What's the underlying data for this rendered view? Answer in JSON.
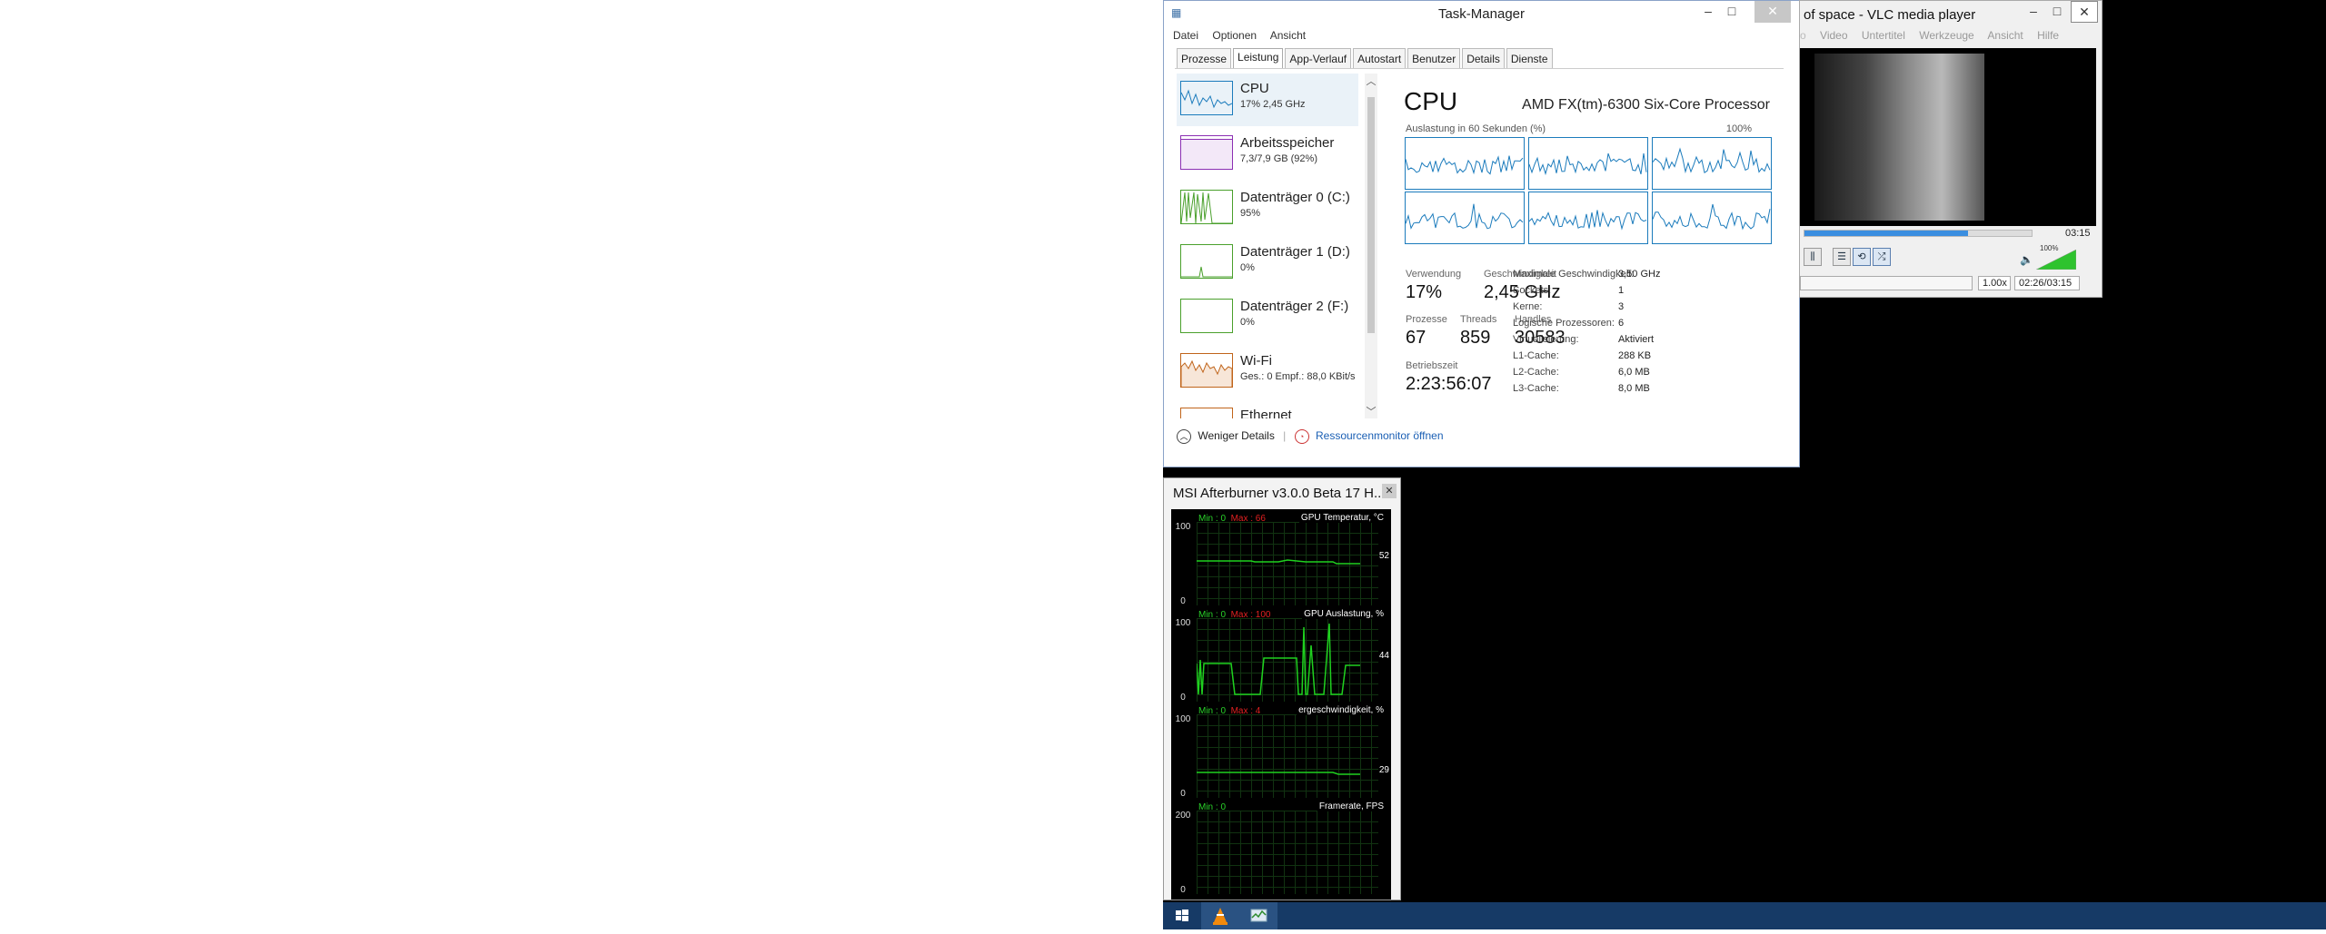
{
  "taskmanager": {
    "title": "Task-Manager",
    "menu": [
      "Datei",
      "Optionen",
      "Ansicht"
    ],
    "tabs": [
      "Prozesse",
      "Leistung",
      "App-Verlauf",
      "Autostart",
      "Benutzer",
      "Details",
      "Dienste"
    ],
    "active_tab": "Leistung",
    "sidebar": [
      {
        "title": "CPU",
        "sub": "17% 2,45 GHz",
        "color": "#1b7bbc"
      },
      {
        "title": "Arbeitsspeicher",
        "sub": "7,3/7,9 GB (92%)",
        "color": "#8b2fb3"
      },
      {
        "title": "Datenträger 0 (C:)",
        "sub": "95%",
        "color": "#4aa02c"
      },
      {
        "title": "Datenträger 1 (D:)",
        "sub": "0%",
        "color": "#4aa02c"
      },
      {
        "title": "Datenträger 2 (F:)",
        "sub": "0%",
        "color": "#4aa02c"
      },
      {
        "title": "Wi-Fi",
        "sub": "Ges.: 0 Empf.: 88,0 KBit/s",
        "color": "#c0641a"
      },
      {
        "title": "Ethernet",
        "sub": "",
        "color": "#c0641a"
      }
    ],
    "cpu": {
      "heading": "CPU",
      "model": "AMD FX(tm)-6300 Six-Core Processor",
      "usage_label": "Auslastung in 60 Sekunden (%)",
      "max_label": "100%",
      "stats": {
        "usage_label": "Verwendung",
        "usage": "17%",
        "speed_label": "Geschwindigkeit",
        "speed": "2,45 GHz",
        "processes_label": "Prozesse",
        "processes": "67",
        "threads_label": "Threads",
        "threads": "859",
        "handles_label": "Handles",
        "handles": "30583",
        "uptime_label": "Betriebszeit",
        "uptime": "2:23:56:07"
      },
      "details": [
        {
          "label": "Maximale Geschwindigkeit:",
          "value": "3,50 GHz"
        },
        {
          "label": "Sockets:",
          "value": "1"
        },
        {
          "label": "Kerne:",
          "value": "3"
        },
        {
          "label": "Logische Prozessoren:",
          "value": "6"
        },
        {
          "label": "Virtualisierung:",
          "value": "Aktiviert"
        },
        {
          "label": "L1-Cache:",
          "value": "288 KB"
        },
        {
          "label": "L2-Cache:",
          "value": "6,0 MB"
        },
        {
          "label": "L3-Cache:",
          "value": "8,0 MB"
        }
      ]
    },
    "footer": {
      "less_details": "Weniger Details",
      "resource_monitor": "Ressourcenmonitor öffnen"
    }
  },
  "vlc": {
    "title": "of space - VLC media player",
    "menu": [
      "Video",
      "Untertitel",
      "Werkzeuge",
      "Ansicht",
      "Hilfe"
    ],
    "time_total": "03:15",
    "progress": 0.72,
    "volume": "100%",
    "speed": "1.00x",
    "time_status": "02:26/03:15"
  },
  "afterburner": {
    "title": "MSI Afterburner v3.0.0 Beta 17 H...",
    "graphs": [
      {
        "name": "GPU Temperatur, °C",
        "min": "Min : 0",
        "max": "Max : 66",
        "top": "100",
        "bottom": "0",
        "current": "52",
        "color": "#1fd11f"
      },
      {
        "name": "GPU Auslastung, %",
        "min": "Min : 0",
        "max": "Max : 100",
        "top": "100",
        "bottom": "0",
        "current": "44",
        "color": "#1fd11f"
      },
      {
        "name": "ergeschwindigkeit, %",
        "min": "Min : 0",
        "max": "Max : 4",
        "top": "100",
        "bottom": "0",
        "current": "29",
        "color": "#1fd11f"
      },
      {
        "name": "Framerate, FPS",
        "min": "Min : 0",
        "max": "",
        "top": "200",
        "bottom": "0",
        "current": "",
        "color": "#1fd11f"
      }
    ]
  },
  "taskbar": {
    "icons": [
      "windows-start-icon",
      "vlc-icon",
      "task-manager-icon"
    ]
  }
}
